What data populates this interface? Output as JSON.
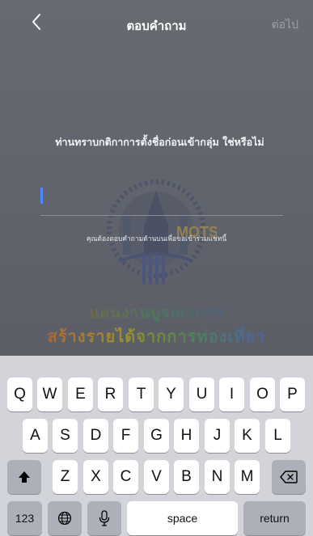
{
  "nav": {
    "title": "ตอบคำถาม",
    "next_label": "ต่อไป"
  },
  "question": {
    "text": "ท่านทราบกติกาการตั้งชื่อก่อนเข้ากลุ่ม ใช่หรือไม่"
  },
  "answer": {
    "value": "",
    "hint": "คุณต้องตอบคำถามด้านบนเพื่อขอเข้าร่วมแชทนี้"
  },
  "watermark": {
    "logo_text": "MOTS",
    "line1": "แผนงานบูรณาการ",
    "line2": "สร้างรายได้จากการท่องเที่ยว"
  },
  "keyboard": {
    "row1": [
      "Q",
      "W",
      "E",
      "R",
      "T",
      "Y",
      "U",
      "I",
      "O",
      "P"
    ],
    "row2": [
      "A",
      "S",
      "D",
      "F",
      "G",
      "H",
      "J",
      "K",
      "L"
    ],
    "row3": [
      "Z",
      "X",
      "C",
      "V",
      "B",
      "N",
      "M"
    ],
    "shift_icon": "shift-icon",
    "delete_icon": "delete-icon",
    "numbers_label": "123",
    "globe_icon": "globe-icon",
    "mic_icon": "microphone-icon",
    "space_label": "space",
    "return_label": "return"
  }
}
